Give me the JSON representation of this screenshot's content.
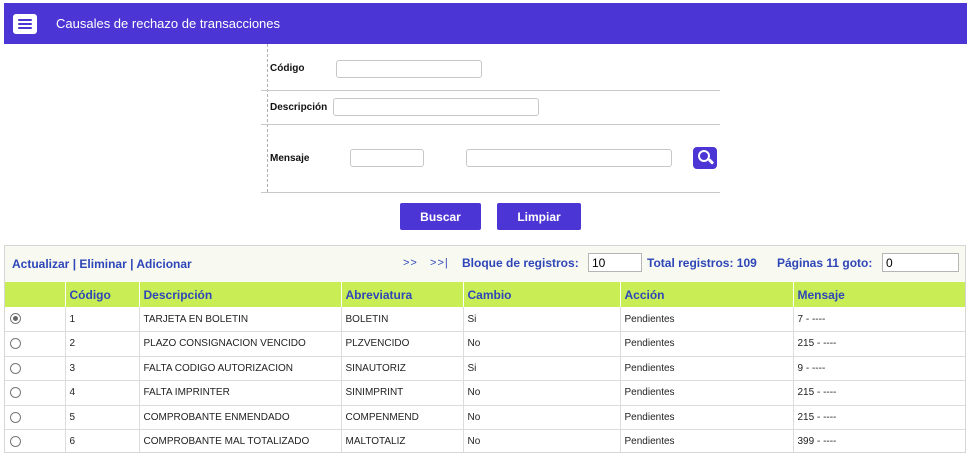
{
  "header": {
    "title": "Causales de rechazo de transacciones",
    "icon": "list-window-icon",
    "color": "#4b35d4"
  },
  "form": {
    "codigo_label": "Código",
    "codigo_value": "",
    "descripcion_label": "Descripción",
    "descripcion_value": "",
    "mensaje_label": "Mensaje",
    "mensaje_code_value": "",
    "mensaje_text_value": "",
    "search_icon": "search-icon"
  },
  "buttons": {
    "buscar": "Buscar",
    "limpiar": "Limpiar"
  },
  "toolbar": {
    "actualizar": "Actualizar",
    "eliminar": "Eliminar",
    "adicionar": "Adicionar",
    "separator": "|",
    "next": ">>",
    "last": ">>|",
    "bloque_label": "Bloque de registros:",
    "bloque_value": "10",
    "total_label": "Total registros: 109",
    "paginas_label": "Páginas 11 goto:",
    "goto_value": "0"
  },
  "table": {
    "headers": [
      "",
      "Código",
      "Descripción",
      "Abreviatura",
      "Cambio",
      "Acción",
      "Mensaje"
    ],
    "rows": [
      {
        "selected": true,
        "codigo": "1",
        "descripcion": "TARJETA EN BOLETIN",
        "abreviatura": "BOLETIN",
        "cambio": "Si",
        "accion": "Pendientes",
        "mensaje": "7 - ----"
      },
      {
        "selected": false,
        "codigo": "2",
        "descripcion": "PLAZO CONSIGNACION VENCIDO",
        "abreviatura": "PLZVENCIDO",
        "cambio": "No",
        "accion": "Pendientes",
        "mensaje": "215 - ----"
      },
      {
        "selected": false,
        "codigo": "3",
        "descripcion": "FALTA CODIGO AUTORIZACION",
        "abreviatura": "SINAUTORIZ",
        "cambio": "Si",
        "accion": "Pendientes",
        "mensaje": "9 - ----"
      },
      {
        "selected": false,
        "codigo": "4",
        "descripcion": "FALTA IMPRINTER",
        "abreviatura": "SINIMPRINT",
        "cambio": "No",
        "accion": "Pendientes",
        "mensaje": "215 - ----"
      },
      {
        "selected": false,
        "codigo": "5",
        "descripcion": "COMPROBANTE ENMENDADO",
        "abreviatura": "COMPENMEND",
        "cambio": "No",
        "accion": "Pendientes",
        "mensaje": "215 - ----"
      },
      {
        "selected": false,
        "codigo": "6",
        "descripcion": "COMPROBANTE MAL TOTALIZADO",
        "abreviatura": "MALTOTALIZ",
        "cambio": "No",
        "accion": "Pendientes",
        "mensaje": "399 - ----"
      }
    ]
  },
  "colors": {
    "accent": "#4b35d4",
    "table_header": "#c9ee55",
    "link": "#2e46b8"
  }
}
